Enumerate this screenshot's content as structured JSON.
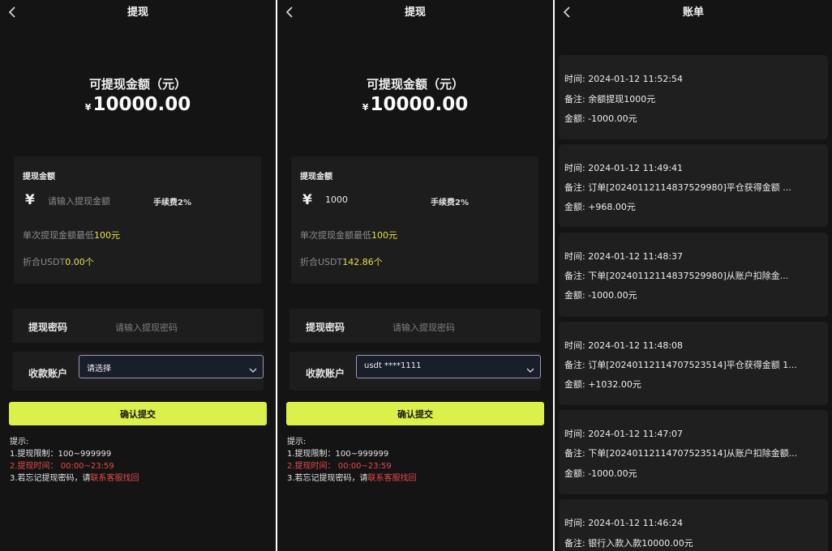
{
  "screen1": {
    "title": "提现",
    "available_label": "可提现金额（元）",
    "currency": "¥",
    "available_amount": "10000.00",
    "card_title": "提现金额",
    "yen": "¥",
    "amount_placeholder": "请输入提现金额",
    "fee": "手续费2%",
    "min_prefix": "单次提现金额最低",
    "min_value": "100元",
    "usdt_prefix": "折合USDT",
    "usdt_value": "0.00个",
    "password_label": "提现密码",
    "password_placeholder": "请输入提现密码",
    "account_label": "收款账户",
    "account_selected": "请选择",
    "submit_label": "确认提交",
    "tips": {
      "heading": "提示:",
      "line1": "1.提现限制：100~999999",
      "line2": "2.提现时间：  00:00~23:59",
      "line3_prefix": "3.若忘记提现密码，请",
      "line3_link": "联系客服找回"
    }
  },
  "screen2": {
    "title": "提现",
    "available_label": "可提现金额（元）",
    "currency": "¥",
    "available_amount": "10000.00",
    "card_title": "提现金额",
    "yen": "¥",
    "amount_value": "1000",
    "fee": "手续费2%",
    "min_prefix": "单次提现金额最低",
    "min_value": "100元",
    "usdt_prefix": "折合USDT",
    "usdt_value": "142.86个",
    "password_label": "提现密码",
    "password_placeholder": "请输入提现密码",
    "account_label": "收款账户",
    "account_selected": "usdt ****1111",
    "submit_label": "确认提交",
    "tips": {
      "heading": "提示:",
      "line1": "1.提现限制：100~999999",
      "line2": "2.提现时间：  00:00~23:59",
      "line3_prefix": "3.若忘记提现密码，请",
      "line3_link": "联系客服找回"
    }
  },
  "screen3": {
    "title": "账单",
    "records": [
      {
        "time": "时间:  2024-01-12 11:52:54",
        "note": "备注:  余额提现1000元",
        "amount": "金额:  -1000.00元"
      },
      {
        "time": "时间:  2024-01-12 11:49:41",
        "note": "备注:  订单[20240112114837529980]平仓获得金额 ...",
        "amount": "金额:  +968.00元"
      },
      {
        "time": "时间:  2024-01-12 11:48:37",
        "note": "备注:  下单[20240112114837529980]从账户扣除金...",
        "amount": "金额:  -1000.00元"
      },
      {
        "time": "时间:  2024-01-12 11:48:08",
        "note": "备注:  订单[20240112114707523514]平仓获得金额 1...",
        "amount": "金额:  +1032.00元"
      },
      {
        "time": "时间:  2024-01-12 11:47:07",
        "note": "备注:  下单[20240112114707523514]从账户扣除金额...",
        "amount": "金额:  -1000.00元"
      },
      {
        "time": "时间:  2024-01-12 11:46:24",
        "note": "备注:  银行入款入款10000.00元",
        "amount": ""
      }
    ]
  },
  "colors": {
    "background": "#141414",
    "card": "#1d1d1d",
    "accent_button": "#dbf04a",
    "highlight": "#e7e04a",
    "warning": "#e84a4a"
  },
  "icons": [
    "chevron-left-icon",
    "chevron-down-icon"
  ]
}
